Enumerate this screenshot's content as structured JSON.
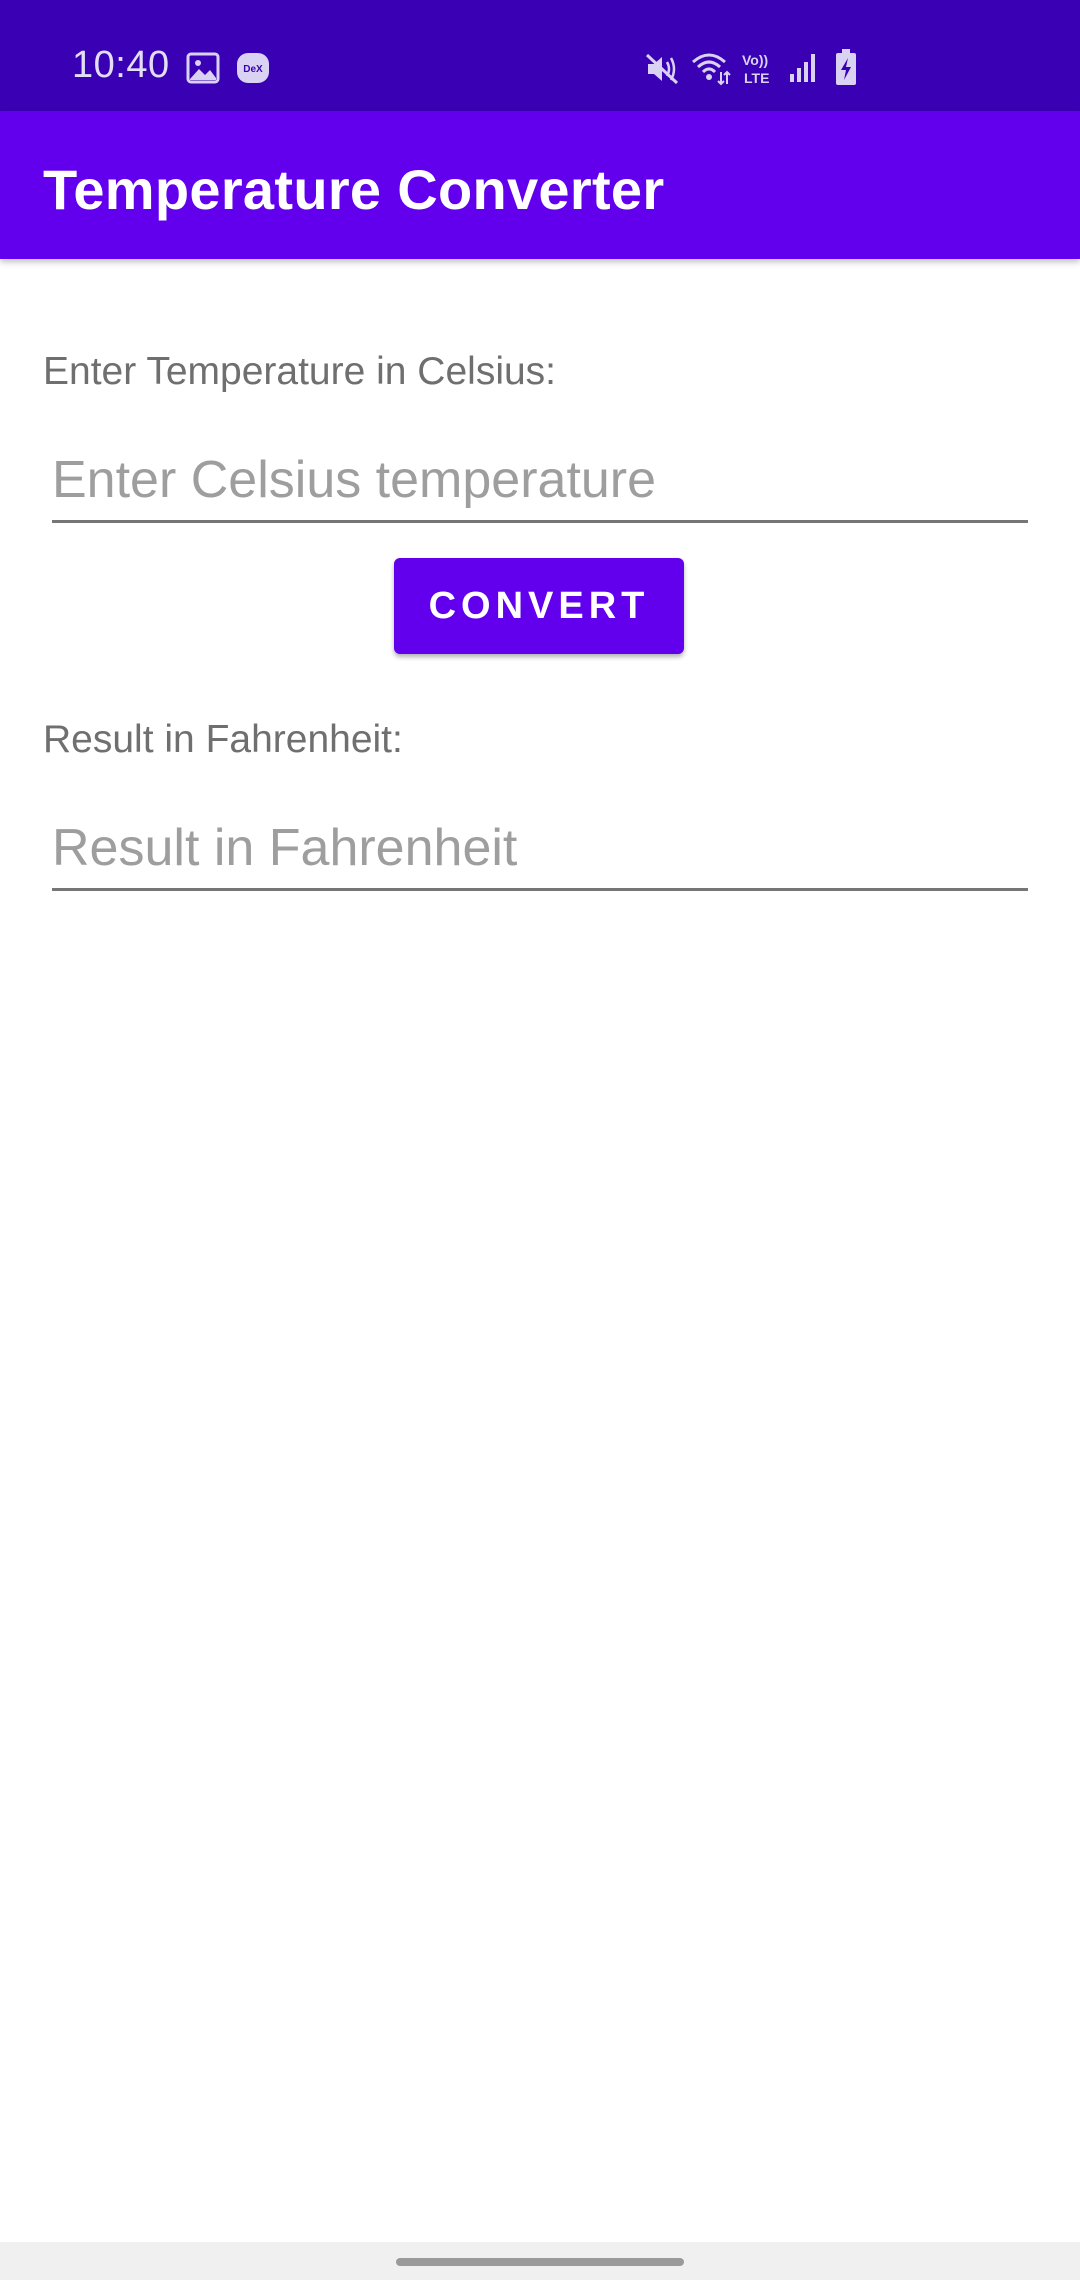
{
  "status_bar": {
    "time": "10:40",
    "background": "#3a00b4",
    "left_icons": [
      "gallery-icon",
      "dex-icon"
    ],
    "dex_label": "DeX",
    "right_icons": [
      "mute-icon",
      "wifi-icon",
      "volte-icon",
      "signal-icon",
      "battery-charging-icon"
    ],
    "volte_label_top": "Vo))",
    "volte_label_bottom": "LTE"
  },
  "app_bar": {
    "title": "Temperature Converter",
    "background": "#6200ee"
  },
  "form": {
    "celsius_label": "Enter Temperature in Celsius:",
    "celsius_input": {
      "value": "",
      "placeholder": "Enter Celsius temperature"
    },
    "convert_label": "CONVERT",
    "result_label": "Result in Fahrenheit:",
    "result_input": {
      "value": "",
      "placeholder": "Result in Fahrenheit"
    }
  },
  "theme": {
    "accent": "#6200ee",
    "status_bar": "#3a00b4"
  }
}
